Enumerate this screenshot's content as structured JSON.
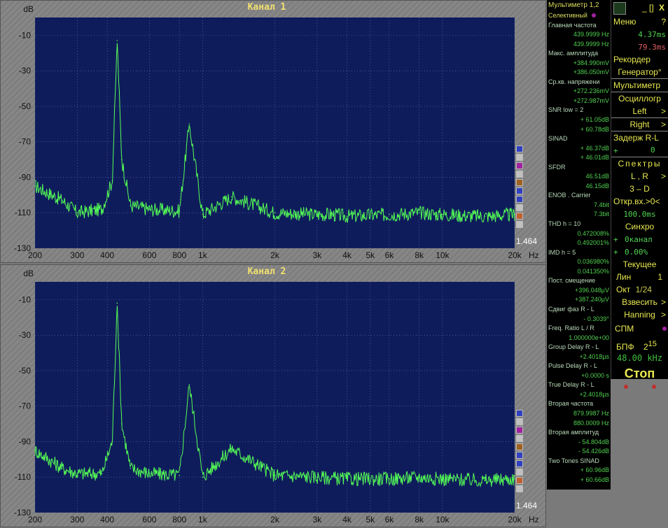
{
  "window": {
    "title": "Мультиметр 1,2"
  },
  "charts": [
    {
      "name": "chart-channel-1",
      "title": "Канал 1",
      "ylabel": "dB",
      "xunit": "Hz",
      "scale_readout": "1.464",
      "yticks": [
        -10,
        -30,
        -50,
        -70,
        -90,
        -110,
        -130
      ],
      "xticks": [
        {
          "v": 200,
          "l": "200"
        },
        {
          "v": 300,
          "l": "300"
        },
        {
          "v": 400,
          "l": "400"
        },
        {
          "v": 600,
          "l": "600"
        },
        {
          "v": 800,
          "l": "800"
        },
        {
          "v": 1000,
          "l": "1k"
        },
        {
          "v": 2000,
          "l": "2k"
        },
        {
          "v": 3000,
          "l": "3k"
        },
        {
          "v": 4000,
          "l": "4k"
        },
        {
          "v": 5000,
          "l": "5k"
        },
        {
          "v": 6000,
          "l": "6k"
        },
        {
          "v": 8000,
          "l": "8k"
        },
        {
          "v": 10000,
          "l": "10k"
        },
        {
          "v": 20000,
          "l": "20k"
        }
      ]
    },
    {
      "name": "chart-channel-2",
      "title": "Канал 2",
      "ylabel": "dB",
      "xunit": "Hz",
      "scale_readout": "1.464",
      "yticks": [
        -10,
        -30,
        -50,
        -70,
        -90,
        -110,
        -130
      ],
      "xticks": [
        {
          "v": 200,
          "l": "200"
        },
        {
          "v": 300,
          "l": "300"
        },
        {
          "v": 400,
          "l": "400"
        },
        {
          "v": 600,
          "l": "600"
        },
        {
          "v": 800,
          "l": "800"
        },
        {
          "v": 1000,
          "l": "1k"
        },
        {
          "v": 2000,
          "l": "2k"
        },
        {
          "v": 3000,
          "l": "3k"
        },
        {
          "v": 4000,
          "l": "4k"
        },
        {
          "v": 5000,
          "l": "5k"
        },
        {
          "v": 6000,
          "l": "6k"
        },
        {
          "v": 8000,
          "l": "8k"
        },
        {
          "v": 10000,
          "l": "10k"
        },
        {
          "v": 20000,
          "l": "20k"
        }
      ]
    }
  ],
  "chart_data": [
    {
      "type": "line",
      "title": "Канал 1",
      "xlabel": "Hz",
      "ylabel": "dB",
      "xscale": "log",
      "xlim": [
        200,
        20000
      ],
      "ylim": [
        -130,
        0
      ],
      "grid": true,
      "series": [
        {
          "x": [
            200,
            260,
            300,
            380,
            420,
            440,
            460,
            500,
            600,
            800,
            880,
            1000,
            1320,
            2000,
            3000,
            3500,
            4000,
            6000,
            8000,
            10000,
            15000,
            20000
          ],
          "y": [
            -95,
            -103,
            -110,
            -108,
            -92,
            -13,
            -80,
            -106,
            -108,
            -109,
            -60,
            -111,
            -101,
            -110,
            -111,
            -111,
            -112,
            -111,
            -110,
            -111,
            -112,
            -111
          ]
        }
      ],
      "color": "#55ff55"
    },
    {
      "type": "line",
      "title": "Канал 2",
      "xlabel": "Hz",
      "ylabel": "dB",
      "xscale": "log",
      "xlim": [
        200,
        20000
      ],
      "ylim": [
        -130,
        0
      ],
      "grid": true,
      "series": [
        {
          "x": [
            200,
            260,
            300,
            380,
            420,
            440,
            460,
            500,
            600,
            800,
            880,
            1000,
            1320,
            2000,
            3000,
            4000,
            6000,
            8000,
            10000,
            15000,
            20000
          ],
          "y": [
            -95,
            -105,
            -108,
            -108,
            -90,
            -12,
            -80,
            -105,
            -108,
            -109,
            -58,
            -110,
            -94,
            -109,
            -110,
            -111,
            -111,
            -110,
            -111,
            -112,
            -111
          ]
        }
      ],
      "color": "#55ff55"
    }
  ],
  "legend_colors": [
    "#3040c0",
    "#c0c0c0",
    "#a020a0",
    "#c0c0c0",
    "#a06020",
    "#3040c0",
    "#3040c0",
    "#c0c0c0",
    "#c06030",
    "#c0c0c0"
  ],
  "measurements": {
    "mode": "Селективный",
    "rows": [
      {
        "t": "h",
        "text": "Главная частота"
      },
      {
        "t": "v",
        "text": "439.9999 Hz"
      },
      {
        "t": "v",
        "text": "439.9999 Hz"
      },
      {
        "t": "h",
        "text": "Макс. амплитуда"
      },
      {
        "t": "v",
        "text": "+384.990mV"
      },
      {
        "t": "v",
        "text": "+386.050mV"
      },
      {
        "t": "h",
        "text": "Ср.кв. напряжени"
      },
      {
        "t": "v",
        "text": "+272.236mV"
      },
      {
        "t": "v",
        "text": "+272.987mV"
      },
      {
        "t": "h",
        "text": "SNR      low = 2"
      },
      {
        "t": "v",
        "text": "+ 61.05dB"
      },
      {
        "t": "v",
        "text": "+ 60.78dB"
      },
      {
        "t": "h",
        "text": "SINAD"
      },
      {
        "t": "v",
        "text": "+ 46.37dB"
      },
      {
        "t": "v",
        "text": "+ 46.01dB"
      },
      {
        "t": "h",
        "text": "SFDR"
      },
      {
        "t": "v",
        "text": "46.51dB"
      },
      {
        "t": "v",
        "text": "46.15dB"
      },
      {
        "t": "h",
        "text": "ENOB . Carrier"
      },
      {
        "t": "v",
        "text": "7.4bit"
      },
      {
        "t": "v",
        "text": "7.3bit"
      },
      {
        "t": "h",
        "text": "THD      h = 10"
      },
      {
        "t": "v",
        "text": "0.472008%"
      },
      {
        "t": "v",
        "text": "0.492001%"
      },
      {
        "t": "h",
        "text": "IMD      h = 5"
      },
      {
        "t": "v",
        "text": "0.036980%"
      },
      {
        "t": "v",
        "text": "0.041350%"
      },
      {
        "t": "h",
        "text": "Пост. смещение"
      },
      {
        "t": "v",
        "text": "+396.048µV"
      },
      {
        "t": "v",
        "text": "+387.240µV"
      },
      {
        "t": "h",
        "text": "Сдвиг фаз R - L"
      },
      {
        "t": "v",
        "text": "- 0.3039°"
      },
      {
        "t": "h",
        "text": "Freq. Ratio  L / R"
      },
      {
        "t": "v",
        "text": "1.000000e+00"
      },
      {
        "t": "h",
        "text": "Group Delay R - L"
      },
      {
        "t": "v",
        "text": "+2.4018µs"
      },
      {
        "t": "h",
        "text": "Pulse Delay R - L"
      },
      {
        "t": "v",
        "text": "+0.0000 s"
      },
      {
        "t": "h",
        "text": "True Delay R - L"
      },
      {
        "t": "v",
        "text": "+2.4018µs"
      },
      {
        "t": "h",
        "text": "Вторая частота"
      },
      {
        "t": "v",
        "text": "879.9987 Hz"
      },
      {
        "t": "v",
        "text": "880.0009 Hz"
      },
      {
        "t": "h",
        "text": "Вторая амплитуд"
      },
      {
        "t": "v",
        "text": "- 54.804dB"
      },
      {
        "t": "v",
        "text": "- 54.426dB"
      },
      {
        "t": "h",
        "text": "Two Tones SINAD"
      },
      {
        "t": "v",
        "text": "+ 60.96dB"
      },
      {
        "t": "v",
        "text": "+ 60.66dB"
      }
    ]
  },
  "controls": {
    "close_label": "X",
    "restore_label": "[]",
    "minimize_label": "_",
    "menu_label": "Меню",
    "help_label": "?",
    "time1": "4.37ms",
    "time2": "79.3ms",
    "recorder": "Рекордер",
    "generator": "Генератор°",
    "multimeter": "Мультиметр",
    "oscilloscope": "Осциллогр",
    "left": "Left",
    "right": "Right",
    "arrow": ">",
    "delay_label": "Задерж R-L",
    "delay_plus": "+",
    "delay_value": "0",
    "spectra": "Спектры",
    "lr": "L , R",
    "three_d": "3 – D",
    "open_input": "Откр.вх.>0<",
    "open_value": "100.0ms",
    "sync": "Синхро",
    "sync_plus1": "+",
    "sync_val1": "0канал",
    "sync_plus2": "+",
    "sync_val2": "0.00%",
    "current": "Текущее",
    "lin": "Лин",
    "lin_value": "1",
    "oct": "Окт",
    "oct_value": "1/24",
    "weigh": "Взвесить",
    "hanning": "Hanning",
    "spm": "СПМ",
    "fft": "БПФ",
    "fft_base": "2",
    "fft_exp": "15",
    "sample_rate": "48.00 kHz",
    "stop": "Стоп"
  }
}
